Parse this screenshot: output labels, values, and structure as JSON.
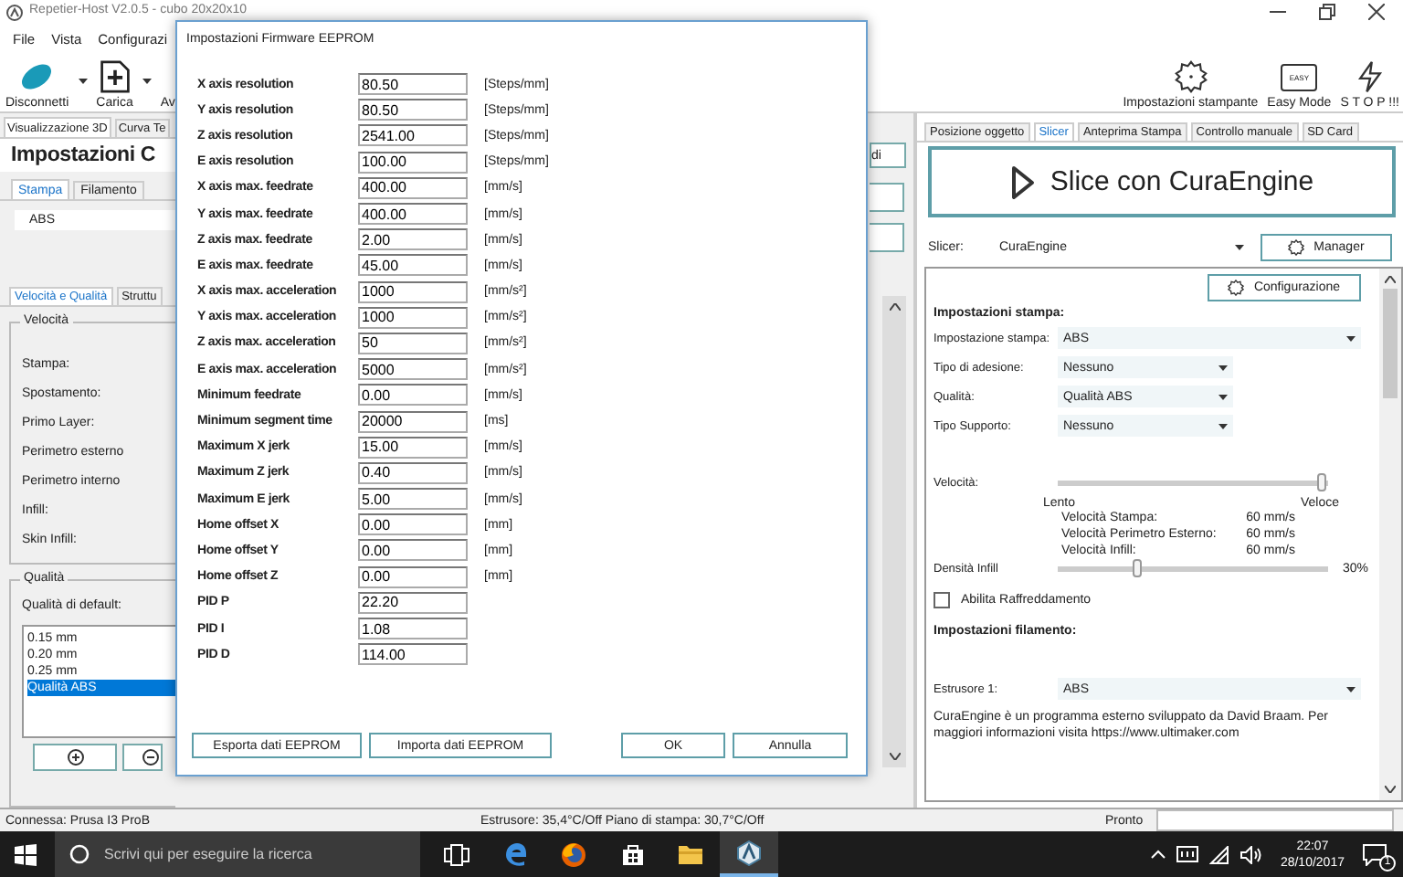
{
  "window": {
    "title": "Repetier-Host V2.0.5 - cubo 20x20x10"
  },
  "menu": [
    "File",
    "Vista",
    "Configurazi"
  ],
  "toolbar": {
    "left": [
      {
        "kind": "connect",
        "label": "Disconnetti"
      },
      {
        "kind": "load",
        "label": "Carica"
      },
      {
        "kind": "partial",
        "label": "Av"
      }
    ],
    "right": [
      {
        "kind": "gear",
        "label": "Impostazioni stampante"
      },
      {
        "kind": "easy",
        "label": "Easy Mode",
        "icon_text": "EASY"
      },
      {
        "kind": "stop",
        "label": "S T O P !!!"
      }
    ]
  },
  "left_panel": {
    "tabs": [
      {
        "label": "Visualizzazione 3D",
        "selected": true
      },
      {
        "label": "Curva Te",
        "selected": false
      }
    ],
    "heading": "Impostazioni C",
    "subtabs": [
      {
        "label": "Stampa",
        "selected": true
      },
      {
        "label": "Filamento",
        "selected": false
      }
    ],
    "profile": "ABS",
    "settings_tabs": [
      {
        "label": "Velocità e Qualità",
        "selected": true
      },
      {
        "label": "Struttu",
        "selected": false
      }
    ],
    "speed_group": {
      "title": "Velocità",
      "labels": [
        "Stampa:",
        "Spostamento:",
        "Primo Layer:",
        "Perimetro esterno",
        "Perimetro interno",
        "Infill:",
        "Skin Infill:"
      ]
    },
    "quality_group": {
      "title": "Qualità",
      "label": "Qualità di default:",
      "items": [
        {
          "label": "0.15 mm",
          "selected": false
        },
        {
          "label": "0.20 mm",
          "selected": false
        },
        {
          "label": "0.25 mm",
          "selected": false
        },
        {
          "label": "Qualità ABS",
          "selected": true
        }
      ]
    },
    "side_button": "di"
  },
  "dialog": {
    "title": "Impostazioni Firmware EEPROM",
    "rows": [
      {
        "label": "X axis resolution",
        "value": "80.50",
        "unit": "[Steps/mm]"
      },
      {
        "label": "Y axis resolution",
        "value": "80.50",
        "unit": "[Steps/mm]"
      },
      {
        "label": "Z axis resolution",
        "value": "2541.00",
        "unit": "[Steps/mm]"
      },
      {
        "label": "E axis resolution",
        "value": "100.00",
        "unit": "[Steps/mm]"
      },
      {
        "label": "X axis max. feedrate",
        "value": "400.00",
        "unit": "[mm/s]"
      },
      {
        "label": "Y axis max. feedrate",
        "value": "400.00",
        "unit": "[mm/s]"
      },
      {
        "label": "Z axis max. feedrate",
        "value": "2.00",
        "unit": "[mm/s]"
      },
      {
        "label": "E axis max. feedrate",
        "value": "45.00",
        "unit": "[mm/s]"
      },
      {
        "label": "X axis max. acceleration",
        "value": "1000",
        "unit": "[mm/s²]"
      },
      {
        "label": "Y axis max. acceleration",
        "value": "1000",
        "unit": "[mm/s²]"
      },
      {
        "label": "Z axis max. acceleration",
        "value": "50",
        "unit": "[mm/s²]"
      },
      {
        "label": "E axis max. acceleration",
        "value": "5000",
        "unit": "[mm/s²]"
      },
      {
        "label": "Minimum feedrate",
        "value": "0.00",
        "unit": "[mm/s]"
      },
      {
        "label": "Minimum segment time",
        "value": "20000",
        "unit": "[ms]"
      },
      {
        "label": "Maximum X jerk",
        "value": "15.00",
        "unit": "[mm/s]"
      },
      {
        "label": "Maximum Z jerk",
        "value": "0.40",
        "unit": "[mm/s]"
      },
      {
        "label": "Maximum E jerk",
        "value": "5.00",
        "unit": "[mm/s]"
      },
      {
        "label": "Home offset X",
        "value": "0.00",
        "unit": "[mm]"
      },
      {
        "label": "Home offset Y",
        "value": "0.00",
        "unit": "[mm]"
      },
      {
        "label": "Home offset Z",
        "value": "0.00",
        "unit": "[mm]"
      },
      {
        "label": "PID P",
        "value": "22.20"
      },
      {
        "label": "PID I",
        "value": "1.08"
      },
      {
        "label": "PID D",
        "value": "114.00"
      }
    ],
    "left_buttons": [
      "Esporta dati EEPROM",
      "Importa dati EEPROM"
    ],
    "right_buttons": [
      "OK",
      "Annulla"
    ]
  },
  "right_panel": {
    "tabs": [
      {
        "label": "Posizione oggetto",
        "selected": false
      },
      {
        "label": "Slicer",
        "selected": true
      },
      {
        "label": "Anteprima Stampa",
        "selected": false
      },
      {
        "label": "Controllo manuale",
        "selected": false
      },
      {
        "label": "SD Card",
        "selected": false
      }
    ],
    "slice_button": "Slice con CuraEngine",
    "slicer": {
      "label": "Slicer:",
      "value": "CuraEngine",
      "button": "Manager"
    },
    "config_button": "Configurazione",
    "print_settings": {
      "title": "Impostazioni stampa:",
      "rows": [
        {
          "label": "Impostazione stampa:",
          "value": "ABS",
          "wide": true
        },
        {
          "label": "Tipo di adesione:",
          "value": "Nessuno",
          "wide": false
        },
        {
          "label": "Qualità:",
          "value": "Qualità ABS",
          "wide": false
        },
        {
          "label": "Tipo Supporto:",
          "value": "Nessuno",
          "wide": false
        }
      ]
    },
    "speed": {
      "label": "Velocità:",
      "level": 0.98,
      "min_label": "Lento",
      "max_label": "Veloce",
      "details": [
        {
          "label": "Velocità Stampa:",
          "value": "60 mm/s"
        },
        {
          "label": "Velocità Perimetro Esterno:",
          "value": "60 mm/s"
        },
        {
          "label": "Velocità Infill:",
          "value": "60 mm/s"
        }
      ]
    },
    "infill": {
      "label": "Densità Infill",
      "level": 0.3,
      "reading": "30%"
    },
    "cooling": {
      "label": "Abilita Raffreddamento",
      "checked": false
    },
    "filament": {
      "title": "Impostazioni filamento:",
      "rows": [
        {
          "label": "Estrusore 1:",
          "value": "ABS"
        }
      ]
    },
    "note": "CuraEngine è un programma esterno sviluppato da David Braam. Per maggiori informazioni visita https://www.ultimaker.com"
  },
  "status_bar": {
    "connection": "Connessa: Prusa I3 ProB",
    "temperatures": "Estrusore: 35,4°C/Off Piano di stampa: 30,7°C/Off",
    "state": "Pronto"
  },
  "taskbar": {
    "search_placeholder": "Scrivi qui per eseguire la ricerca",
    "apps": [
      {
        "kind": "taskview",
        "active": false
      },
      {
        "kind": "edge",
        "active": false
      },
      {
        "kind": "firefox",
        "active": false
      },
      {
        "kind": "store",
        "active": false
      },
      {
        "kind": "explorer",
        "active": false
      },
      {
        "kind": "repetier",
        "active": true
      }
    ],
    "time": "22:07",
    "date": "28/10/2017",
    "notifications": "1"
  }
}
